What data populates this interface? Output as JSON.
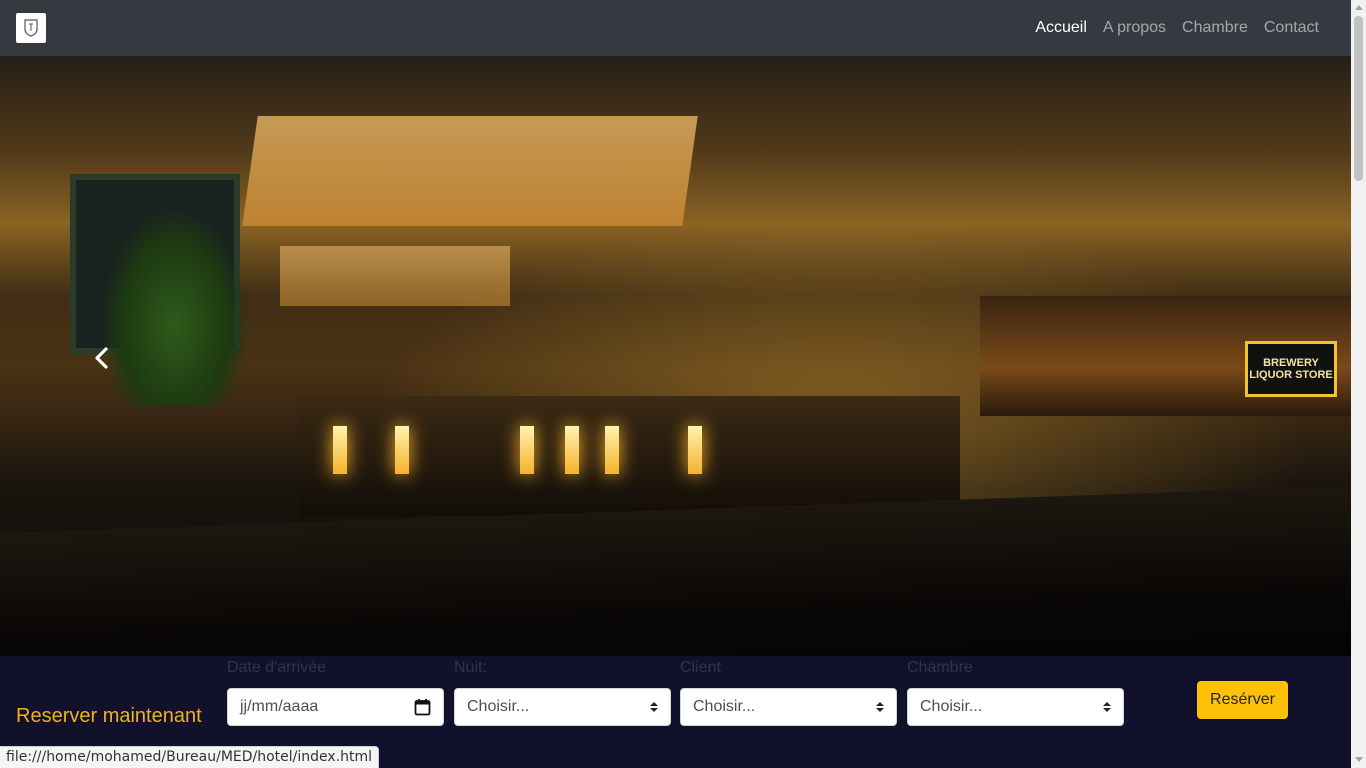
{
  "navbar": {
    "logo_icon": "hotel-crest-icon",
    "links": [
      {
        "label": "Accueil",
        "active": true
      },
      {
        "label": "A propos",
        "active": false
      },
      {
        "label": "Chambre",
        "active": false
      },
      {
        "label": "Contact",
        "active": false
      }
    ]
  },
  "hero": {
    "sign_text": "BREWERY LIQUOR STORE",
    "prev_icon": "chevron-left-icon"
  },
  "booking": {
    "title": "Reserver maintenant",
    "fields": [
      {
        "label": "Date d'arrivée",
        "value": "jj/mm/aaaa",
        "type": "date"
      },
      {
        "label": "Nuit:",
        "value": "Choisir...",
        "type": "select"
      },
      {
        "label": "Client",
        "value": "Choisir...",
        "type": "select"
      },
      {
        "label": "Chambre",
        "value": "Choisir...",
        "type": "select"
      }
    ],
    "submit_label": "Resérver"
  },
  "status_bar": {
    "url": "file:///home/mohamed/Bureau/MED/hotel/index.html"
  },
  "colors": {
    "navbar_bg": "#343a40",
    "booking_bg": "#11112b",
    "accent": "#f0b21c",
    "button_bg": "#ffc107"
  }
}
